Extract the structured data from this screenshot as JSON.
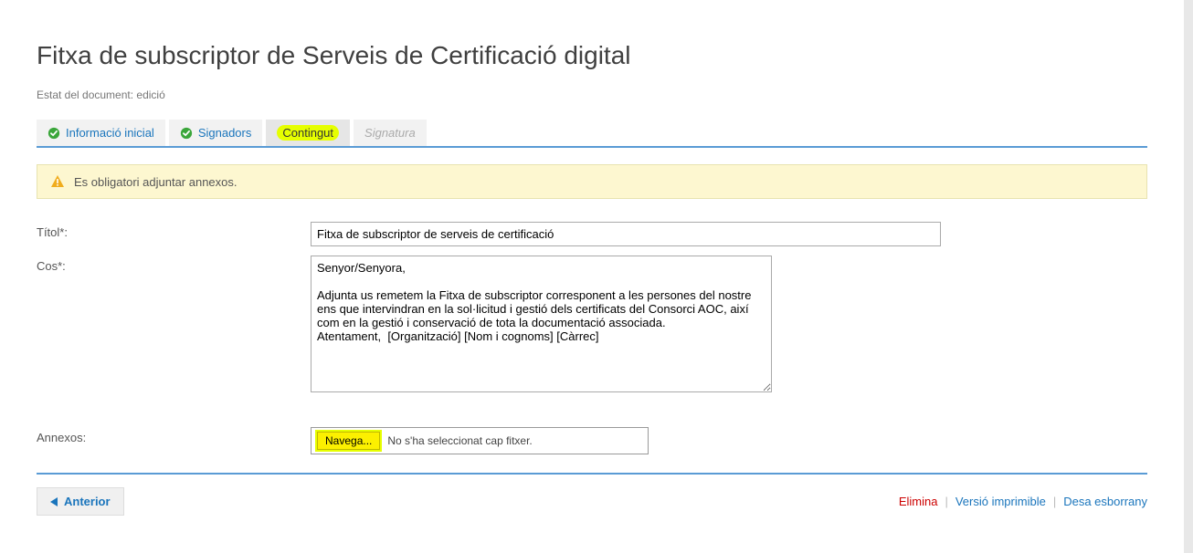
{
  "pageTitle": "Fitxa de subscriptor de Serveis de Certificació digital",
  "docStatusLabel": "Estat del document: edició",
  "tabs": {
    "info": "Informació inicial",
    "signers": "Signadors",
    "content": "Contingut",
    "signature": "Signatura"
  },
  "alertText": "Es obligatori adjuntar annexos.",
  "labels": {
    "title": "Títol*:",
    "body": "Cos*:",
    "attachments": "Annexos:"
  },
  "fields": {
    "titleValue": "Fitxa de subscriptor de serveis de certificació",
    "bodyValue": "Senyor/Senyora,\n\nAdjunta us remetem la Fitxa de subscriptor corresponent a les persones del nostre ens que intervindran en la sol·licitud i gestió dels certificats del Consorci AOC, així com en la gestió i conservació de tota la documentació associada.\nAtentament,  [Organització] [Nom i cognoms] [Càrrec]"
  },
  "fileBrowse": {
    "button": "Navega...",
    "status": "No s'ha seleccionat cap fitxer."
  },
  "footer": {
    "prev": "Anterior",
    "delete": "Elimina",
    "printable": "Versió imprimible",
    "saveDraft": "Desa esborrany"
  }
}
